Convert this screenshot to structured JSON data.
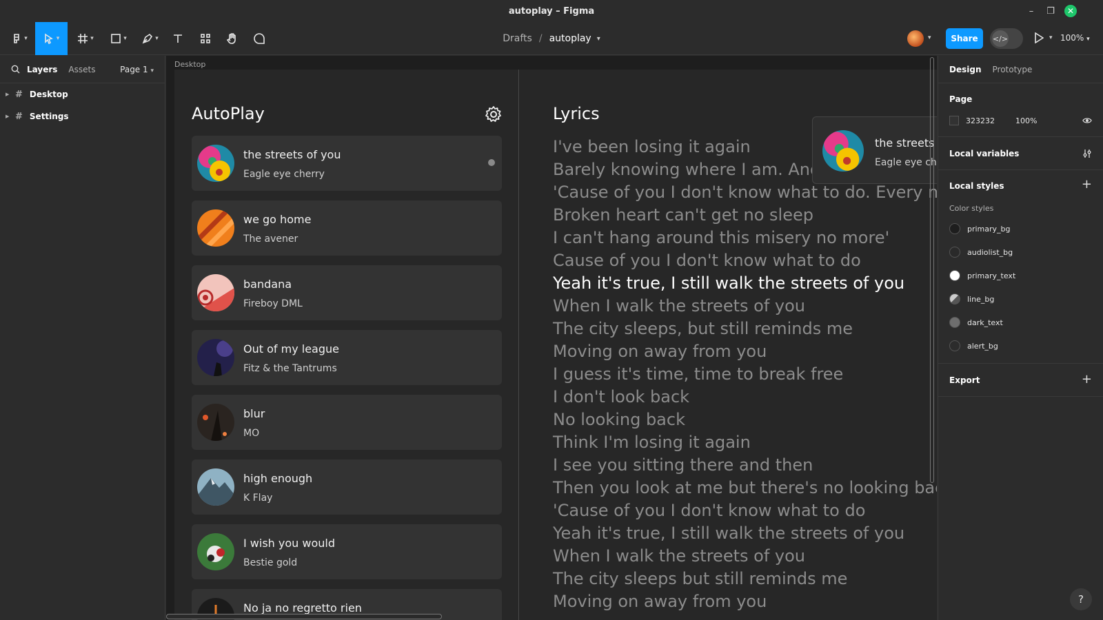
{
  "window": {
    "title": "autoplay – Figma"
  },
  "breadcrumb": {
    "drafts": "Drafts",
    "separator": "/",
    "file": "autoplay"
  },
  "toolbar": {
    "share": "Share",
    "zoom": "100%"
  },
  "left_panel": {
    "tabs": {
      "layers": "Layers",
      "assets": "Assets"
    },
    "page_selector": "Page 1",
    "layers": [
      {
        "name": "Desktop"
      },
      {
        "name": "Settings"
      }
    ]
  },
  "canvas": {
    "frame_label": "Desktop",
    "autoplay": {
      "title": "AutoPlay",
      "songs": [
        {
          "title": "the streets of you",
          "artist": "Eagle eye cherry",
          "playing": true
        },
        {
          "title": "we go home",
          "artist": "The avener"
        },
        {
          "title": "bandana",
          "artist": "Fireboy DML"
        },
        {
          "title": "Out of my league",
          "artist": "Fitz & the Tantrums"
        },
        {
          "title": "blur",
          "artist": "MO"
        },
        {
          "title": "high enough",
          "artist": "K Flay"
        },
        {
          "title": "I wish you would",
          "artist": "Bestie gold"
        },
        {
          "title": "No ja no regretto rien",
          "artist": ""
        }
      ]
    },
    "lyrics": {
      "title": "Lyrics",
      "now_playing": {
        "title": "the streets of you",
        "artist": "Eagle eye cherry"
      },
      "current_index": 6,
      "lines": [
        "I've been losing it again",
        "Barely knowing where I am. And I've been pacing here",
        "'Cause of you I don't know what to do. Every minute",
        "Broken heart can't get no sleep",
        "I can't hang around this misery no more'",
        "Cause of you I don't know what to do",
        "Yeah it's true, I still walk the streets of you",
        "When I walk the streets of you",
        "The city sleeps, but still reminds me",
        "Moving on away from you",
        "I guess it's time, time to break free",
        "I don't look back",
        "No looking back",
        "Think I'm losing it again",
        "I see you sitting there and then",
        "Then you look at me but there's no looking back",
        "'Cause of you I don't know what to do",
        "Yeah it's true, I still walk the streets of you",
        "When I walk the streets of you",
        "The city sleeps but still reminds me",
        "Moving on away from you"
      ]
    }
  },
  "right_panel": {
    "tabs": {
      "design": "Design",
      "prototype": "Prototype"
    },
    "page": {
      "label": "Page",
      "color": "323232",
      "opacity": "100%"
    },
    "local_variables": "Local variables",
    "local_styles": "Local styles",
    "color_styles_label": "Color styles",
    "color_styles": [
      {
        "name": "primary_bg",
        "color": "#1e1e1e"
      },
      {
        "name": "audiolist_bg",
        "color": "#2a2a2a"
      },
      {
        "name": "primary_text",
        "color": "#ffffff"
      },
      {
        "name": "line_bg",
        "color": "#8a8a8a"
      },
      {
        "name": "dark_text",
        "color": "#6e6e6e"
      },
      {
        "name": "alert_bg",
        "color": "#2c2c2c"
      }
    ],
    "export": "Export"
  },
  "help": "?"
}
